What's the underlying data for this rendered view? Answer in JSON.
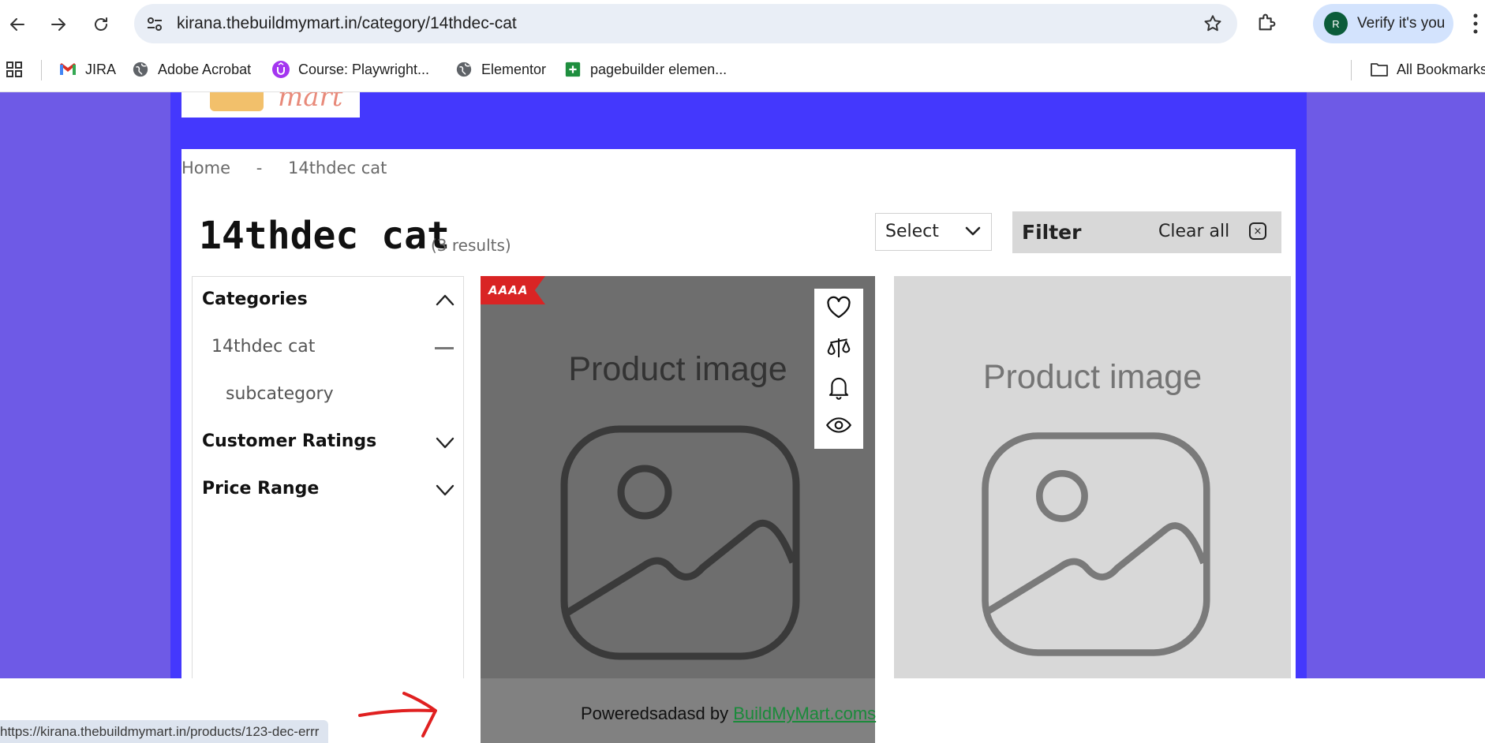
{
  "browser": {
    "url": "kirana.thebuildmymart.in/category/14thdec-cat",
    "profile_label": "Verify it's you",
    "profile_initial": "R",
    "bookmarks": [
      "JIRA",
      "Adobe Acrobat",
      "Course: Playwright...",
      "Elementor",
      "pagebuilder elemen..."
    ],
    "all_bookmarks": "All Bookmarks"
  },
  "page": {
    "logo_text": "mart",
    "breadcrumb": {
      "home": "Home",
      "separator": "-",
      "current": "14thdec cat"
    },
    "title": "14thdec cat",
    "results": "(3 results)",
    "sort_select": "Select",
    "filter": {
      "label": "Filter",
      "clear_all": "Clear all",
      "clear_icon": "×"
    },
    "sidebar": {
      "categories": "Categories",
      "category_item": "14thdec cat",
      "subcategory_item": "subcategory",
      "customer_ratings": "Customer Ratings",
      "price_range": "Price Range"
    },
    "products": [
      {
        "image_text": "Product image",
        "badge": "AAAA"
      },
      {
        "image_text": "Product image"
      }
    ]
  },
  "footer": {
    "powered_prefix": "Poweredsadasd by ",
    "powered_link": "BuildMyMart.coms"
  },
  "status_bar_url": "https://kirana.thebuildmymart.in/products/123-dec-errr",
  "colors": {
    "page_bg": "#6e5ae6",
    "inner_bg": "#4438fd",
    "badge": "#d92424",
    "link_green": "#1a8a3a"
  }
}
